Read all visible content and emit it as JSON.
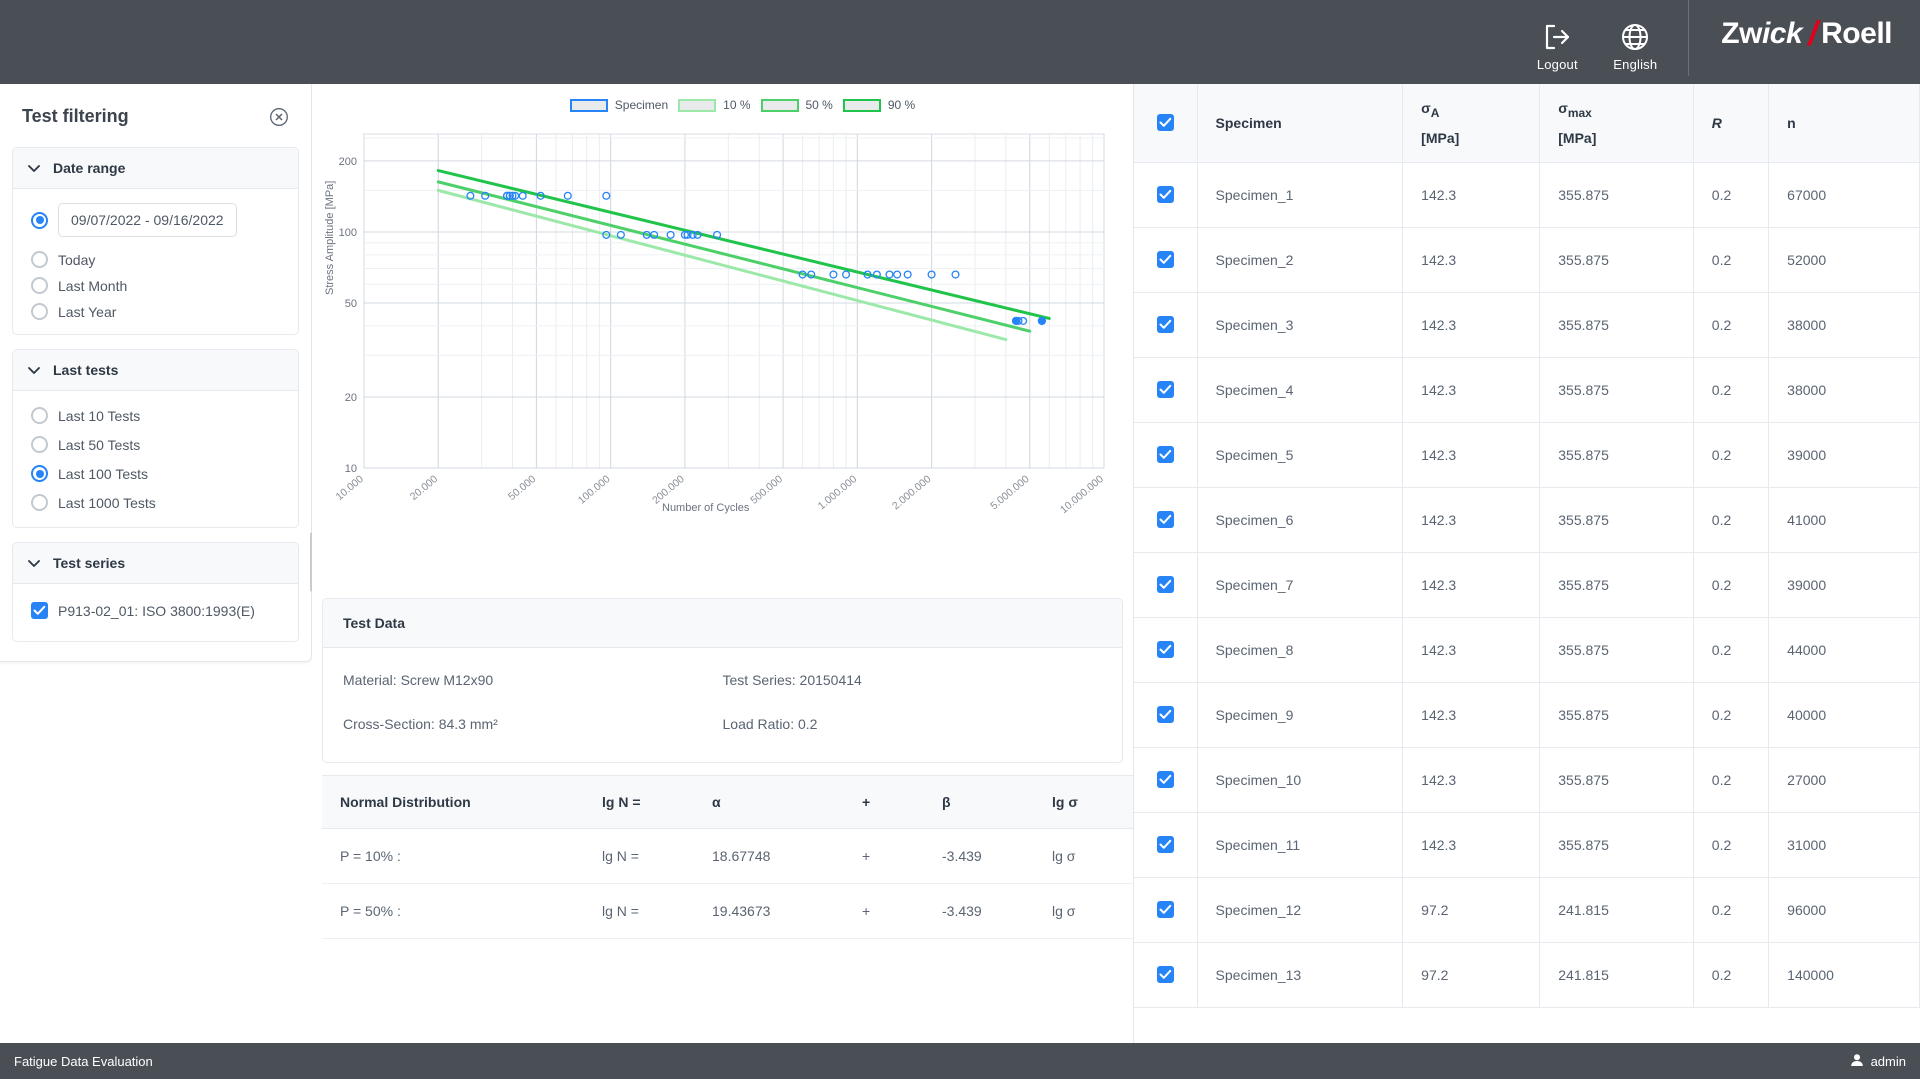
{
  "header": {
    "logout_label": "Logout",
    "logout_icon": "logout-icon",
    "language_label": "English",
    "language_icon": "globe-icon",
    "brand_part1": "Zw",
    "brand_part2": "ick",
    "brand_slash": "/",
    "brand_part3": "Roell",
    "brand_accent": "#e2001a"
  },
  "filter_panel": {
    "title": "Test filtering",
    "close_icon": "close-circle-icon",
    "groups": [
      {
        "title": "Date range",
        "chevron": "chevron-down-icon",
        "date_value": "09/07/2022 - 09/16/2022",
        "options": [
          {
            "label": "09/07/2022 - 09/16/2022",
            "selected": true,
            "is_input": true
          },
          {
            "label": "Today",
            "selected": false
          },
          {
            "label": "Last Month",
            "selected": false
          },
          {
            "label": "Last Year",
            "selected": false
          }
        ]
      },
      {
        "title": "Last tests",
        "chevron": "chevron-down-icon",
        "options": [
          {
            "label": "Last 10 Tests",
            "selected": false
          },
          {
            "label": "Last 50 Tests",
            "selected": false
          },
          {
            "label": "Last 100 Tests",
            "selected": true
          },
          {
            "label": "Last 1000 Tests",
            "selected": false
          }
        ]
      },
      {
        "title": "Test series",
        "chevron": "chevron-down-icon",
        "checkboxes": [
          {
            "label": "P913-02_01: ISO 3800:1993(E)",
            "checked": true
          }
        ]
      }
    ]
  },
  "chart_data": {
    "type": "scatter",
    "title": "",
    "xlabel": "Number of Cycles",
    "ylabel": "Stress Amplitude [MPa]",
    "xscale": "log",
    "yscale": "log",
    "xlim": [
      10000,
      10000000
    ],
    "ylim": [
      10,
      260
    ],
    "grid": true,
    "legend_position": "top",
    "xticks": [
      "10.000",
      "20.000",
      "50.000",
      "100.000",
      "200.000",
      "500.000",
      "1.000.000",
      "2.000.000",
      "5.000.000",
      "10.000.000"
    ],
    "xtick_values": [
      10000,
      20000,
      50000,
      100000,
      200000,
      500000,
      1000000,
      2000000,
      5000000,
      10000000
    ],
    "yticks": [
      "200",
      "100",
      "50",
      "20",
      "10"
    ],
    "ytick_values": [
      200,
      100,
      50,
      20,
      10
    ],
    "legend": [
      {
        "name": "Specimen",
        "color": "#2684f7"
      },
      {
        "name": "10 %",
        "color": "#9ce8a9"
      },
      {
        "name": "50 %",
        "color": "#4dd06a"
      },
      {
        "name": "90 %",
        "color": "#21c44b"
      }
    ],
    "series": [
      {
        "name": "Specimen",
        "type": "scatter",
        "marker": "open-circle",
        "color": "#2684f7",
        "points": [
          [
            27000,
            142.3
          ],
          [
            31000,
            142.3
          ],
          [
            38000,
            142.3
          ],
          [
            38000,
            142.3
          ],
          [
            39000,
            142.3
          ],
          [
            39000,
            142.3
          ],
          [
            40000,
            142.3
          ],
          [
            41000,
            142.3
          ],
          [
            44000,
            142.3
          ],
          [
            52000,
            142.3
          ],
          [
            67000,
            142.3
          ],
          [
            96000,
            142.3
          ],
          [
            96000,
            97.2
          ],
          [
            110000,
            97.2
          ],
          [
            140000,
            97.2
          ],
          [
            150000,
            97.2
          ],
          [
            175000,
            97.2
          ],
          [
            200000,
            97.2
          ],
          [
            205000,
            97.2
          ],
          [
            215000,
            97.2
          ],
          [
            225000,
            97.2
          ],
          [
            270000,
            97.2
          ],
          [
            600000,
            66.0
          ],
          [
            650000,
            66.0
          ],
          [
            800000,
            66.0
          ],
          [
            900000,
            66.0
          ],
          [
            1100000,
            66.0
          ],
          [
            1200000,
            66.0
          ],
          [
            1350000,
            66.0
          ],
          [
            1450000,
            66.0
          ],
          [
            1600000,
            66.0
          ],
          [
            2000000,
            66.0
          ],
          [
            2500000,
            66.0
          ],
          [
            4400000,
            42.0
          ],
          [
            4500000,
            42.0
          ],
          [
            4700000,
            42.0
          ],
          [
            5600000,
            42.0
          ]
        ]
      },
      {
        "name": "10 %",
        "type": "line",
        "color": "#9ce8a9",
        "endpoints": [
          [
            20000,
            150
          ],
          [
            4000000,
            35
          ]
        ]
      },
      {
        "name": "50 %",
        "type": "line",
        "color": "#4dd06a",
        "endpoints": [
          [
            20000,
            163
          ],
          [
            5000000,
            38
          ]
        ]
      },
      {
        "name": "90 %",
        "type": "line",
        "color": "#21c44b",
        "endpoints": [
          [
            20000,
            182
          ],
          [
            6000000,
            43
          ]
        ]
      }
    ]
  },
  "test_data": {
    "card_title": "Test Data",
    "left": [
      "Material: Screw M12x90",
      "Cross-Section: 84.3 mm²"
    ],
    "right": [
      "Test Series: 20150414",
      "Load Ratio: 0.2"
    ]
  },
  "normal_distribution": {
    "headers": [
      "Normal Distribution",
      "lg N =",
      "α",
      "+",
      "β",
      "lg σ"
    ],
    "rows": [
      {
        "p": "P = 10% :",
        "lgn": "lg N =",
        "alpha": "18.67748",
        "plus": "+",
        "beta": "-3.439",
        "lgs": "lg σ"
      },
      {
        "p": "P = 50% :",
        "lgn": "lg N =",
        "alpha": "19.43673",
        "plus": "+",
        "beta": "-3.439",
        "lgs": "lg σ"
      }
    ]
  },
  "specimen_table": {
    "header_checkbox": true,
    "headers": {
      "specimen": "Specimen",
      "sigma_a": "σ",
      "sigma_a_sub": "A",
      "sigma_a_unit": "[MPa]",
      "sigma_max": "σ",
      "sigma_max_sub": "max",
      "sigma_max_unit": "[MPa]",
      "r": "R",
      "n": "n"
    },
    "rows": [
      {
        "checked": true,
        "specimen": "Specimen_1",
        "sigma_a": "142.3",
        "sigma_max": "355.875",
        "r": "0.2",
        "n": "67000"
      },
      {
        "checked": true,
        "specimen": "Specimen_2",
        "sigma_a": "142.3",
        "sigma_max": "355.875",
        "r": "0.2",
        "n": "52000"
      },
      {
        "checked": true,
        "specimen": "Specimen_3",
        "sigma_a": "142.3",
        "sigma_max": "355.875",
        "r": "0.2",
        "n": "38000"
      },
      {
        "checked": true,
        "specimen": "Specimen_4",
        "sigma_a": "142.3",
        "sigma_max": "355.875",
        "r": "0.2",
        "n": "38000"
      },
      {
        "checked": true,
        "specimen": "Specimen_5",
        "sigma_a": "142.3",
        "sigma_max": "355.875",
        "r": "0.2",
        "n": "39000"
      },
      {
        "checked": true,
        "specimen": "Specimen_6",
        "sigma_a": "142.3",
        "sigma_max": "355.875",
        "r": "0.2",
        "n": "41000"
      },
      {
        "checked": true,
        "specimen": "Specimen_7",
        "sigma_a": "142.3",
        "sigma_max": "355.875",
        "r": "0.2",
        "n": "39000"
      },
      {
        "checked": true,
        "specimen": "Specimen_8",
        "sigma_a": "142.3",
        "sigma_max": "355.875",
        "r": "0.2",
        "n": "44000"
      },
      {
        "checked": true,
        "specimen": "Specimen_9",
        "sigma_a": "142.3",
        "sigma_max": "355.875",
        "r": "0.2",
        "n": "40000"
      },
      {
        "checked": true,
        "specimen": "Specimen_10",
        "sigma_a": "142.3",
        "sigma_max": "355.875",
        "r": "0.2",
        "n": "27000"
      },
      {
        "checked": true,
        "specimen": "Specimen_11",
        "sigma_a": "142.3",
        "sigma_max": "355.875",
        "r": "0.2",
        "n": "31000"
      },
      {
        "checked": true,
        "specimen": "Specimen_12",
        "sigma_a": "97.2",
        "sigma_max": "241.815",
        "r": "0.2",
        "n": "96000"
      },
      {
        "checked": true,
        "specimen": "Specimen_13",
        "sigma_a": "97.2",
        "sigma_max": "241.815",
        "r": "0.2",
        "n": "140000"
      }
    ]
  },
  "footer": {
    "title": "Fatigue Data Evaluation",
    "user": "admin",
    "user_icon": "user-icon"
  }
}
